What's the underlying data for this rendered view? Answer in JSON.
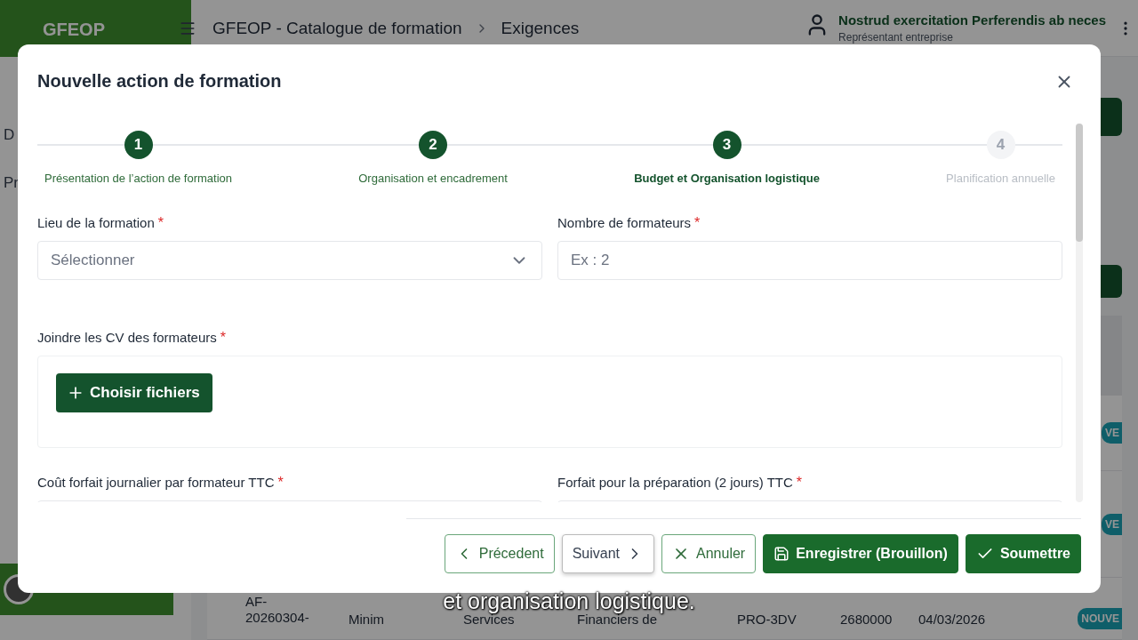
{
  "header": {
    "logo": "GFEOP",
    "breadcrumb": [
      "GFEOP - Catalogue de formation",
      "Exigences"
    ],
    "user": {
      "name": "Nostrud exercitation Perferendis ab neces",
      "role": "Représentant entreprise"
    }
  },
  "sidebar": {
    "items": [
      "D",
      "Pr"
    ]
  },
  "table": {
    "rows": [
      {
        "cells": [],
        "badge": "VE"
      },
      {
        "cells": [],
        "badge": "VE"
      },
      {
        "cells": [
          "AF-\n20260304-",
          "Minim",
          "Services",
          "Financiers de",
          "PRO-3DV",
          "2680000",
          "04/03/2026"
        ],
        "badge": "NOUVE"
      }
    ]
  },
  "modal": {
    "title": "Nouvelle action de formation",
    "steps": [
      {
        "number": "1",
        "label": "Présentation de l’action de formation",
        "completed": true,
        "selected": false
      },
      {
        "number": "2",
        "label": "Organisation et encadrement",
        "completed": true,
        "selected": false
      },
      {
        "number": "3",
        "label": "Budget et Organisation logistique",
        "completed": false,
        "selected": true
      },
      {
        "number": "4",
        "label": "Planification annuelle",
        "completed": false,
        "selected": false
      }
    ],
    "fields": [
      {
        "kind": "select",
        "label": "Lieu de la formation",
        "required_mark": "*",
        "placeholder": "Sélectionner"
      },
      {
        "kind": "input",
        "label": "Nombre de formateurs",
        "required_mark": "*",
        "placeholder": "Ex : 2"
      },
      {
        "kind": "upload",
        "label": "Joindre les CV des formateurs",
        "required_mark": "*",
        "button": "Choisir fichiers"
      },
      {
        "kind": "input",
        "label": "Coût forfait journalier par formateur TTC",
        "required_mark": "*"
      },
      {
        "kind": "input",
        "label": "Forfait pour la préparation (2 jours) TTC",
        "required_mark": "*"
      }
    ],
    "buttons": [
      {
        "kind": "prev",
        "label": "Précedent"
      },
      {
        "kind": "next",
        "label": "Suivant"
      },
      {
        "kind": "cancel",
        "label": "Annuler"
      },
      {
        "kind": "save",
        "label": "Enregistrer (Brouillon)"
      },
      {
        "kind": "submit",
        "label": "Soumettre"
      }
    ]
  },
  "caption": "et organisation logistique."
}
